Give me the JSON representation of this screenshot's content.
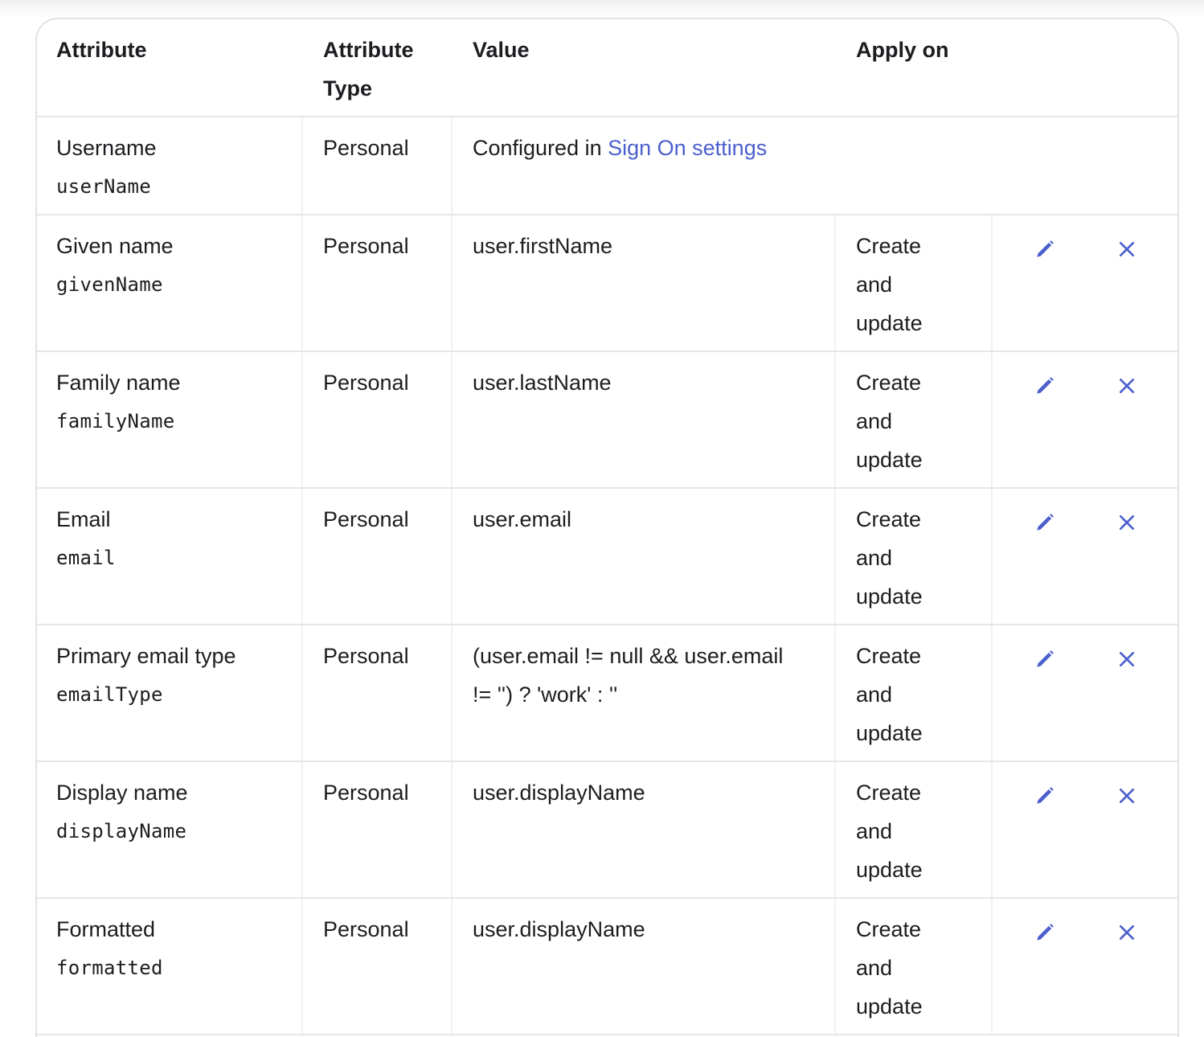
{
  "table": {
    "headers": {
      "attribute": "Attribute",
      "attribute_type_line1": "Attribute",
      "attribute_type_line2": "Type",
      "value": "Value",
      "apply_on": "Apply on"
    },
    "rows": [
      {
        "label": "Username",
        "key": "userName",
        "type": "Personal",
        "value_prefix": "Configured in ",
        "value_link": "Sign On settings",
        "apply_on": [
          "",
          "",
          ""
        ],
        "editable": false
      },
      {
        "label": "Given name",
        "key": "givenName",
        "type": "Personal",
        "value_line1": "user.firstName",
        "value_line2": "",
        "apply_on": [
          "Create",
          "and",
          "update"
        ],
        "editable": true
      },
      {
        "label": "Family name",
        "key": "familyName",
        "type": "Personal",
        "value_line1": "user.lastName",
        "value_line2": "",
        "apply_on": [
          "Create",
          "and",
          "update"
        ],
        "editable": true
      },
      {
        "label": "Email",
        "key": "email",
        "type": "Personal",
        "value_line1": "user.email",
        "value_line2": "",
        "apply_on": [
          "Create",
          "and",
          "update"
        ],
        "editable": true
      },
      {
        "label": "Primary email type",
        "key": "emailType",
        "type": "Personal",
        "value_line1": "(user.email != null && user.email",
        "value_line2": "!= '') ? 'work' : ''",
        "apply_on": [
          "Create",
          "and",
          "update"
        ],
        "editable": true
      },
      {
        "label": "Display name",
        "key": "displayName",
        "type": "Personal",
        "value_line1": "user.displayName",
        "value_line2": "",
        "apply_on": [
          "Create",
          "and",
          "update"
        ],
        "editable": true
      },
      {
        "label": "Formatted",
        "key": "formatted",
        "type": "Personal",
        "value_line1": "user.displayName",
        "value_line2": "",
        "apply_on": [
          "Create",
          "and",
          "update"
        ],
        "editable": true
      }
    ]
  },
  "icons": {
    "edit": "pencil-icon",
    "remove": "close-icon",
    "accent": "#4b5fce"
  }
}
